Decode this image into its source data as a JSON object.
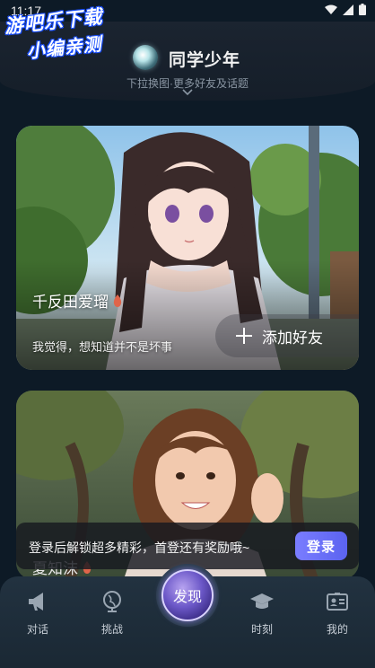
{
  "status_bar": {
    "time": "11:17"
  },
  "watermark": {
    "line1": "游吧乐下载",
    "line2": "小编亲测"
  },
  "header": {
    "title": "同学少年",
    "hint": "下拉换图·更多好友及话题"
  },
  "cards": [
    {
      "name": "千反田爱瑠",
      "quote": "我觉得，想知道并不是坏事",
      "add_friend_label": "添加好友"
    },
    {
      "name": "夏知沫"
    }
  ],
  "login_banner": {
    "text": "登录后解锁超多精彩，首登还有奖励哦~",
    "button_label": "登录"
  },
  "bottom_nav": {
    "items": [
      {
        "label": "对话",
        "icon": "megaphone-icon"
      },
      {
        "label": "挑战",
        "icon": "globe-icon"
      },
      {
        "label": "发现",
        "icon": "discover-orb"
      },
      {
        "label": "时刻",
        "icon": "graduation-cap-icon"
      },
      {
        "label": "我的",
        "icon": "id-card-icon"
      }
    ]
  },
  "colors": {
    "background": "#0d1a26",
    "accent": "#6b70f5",
    "flame": "#e0654a"
  }
}
